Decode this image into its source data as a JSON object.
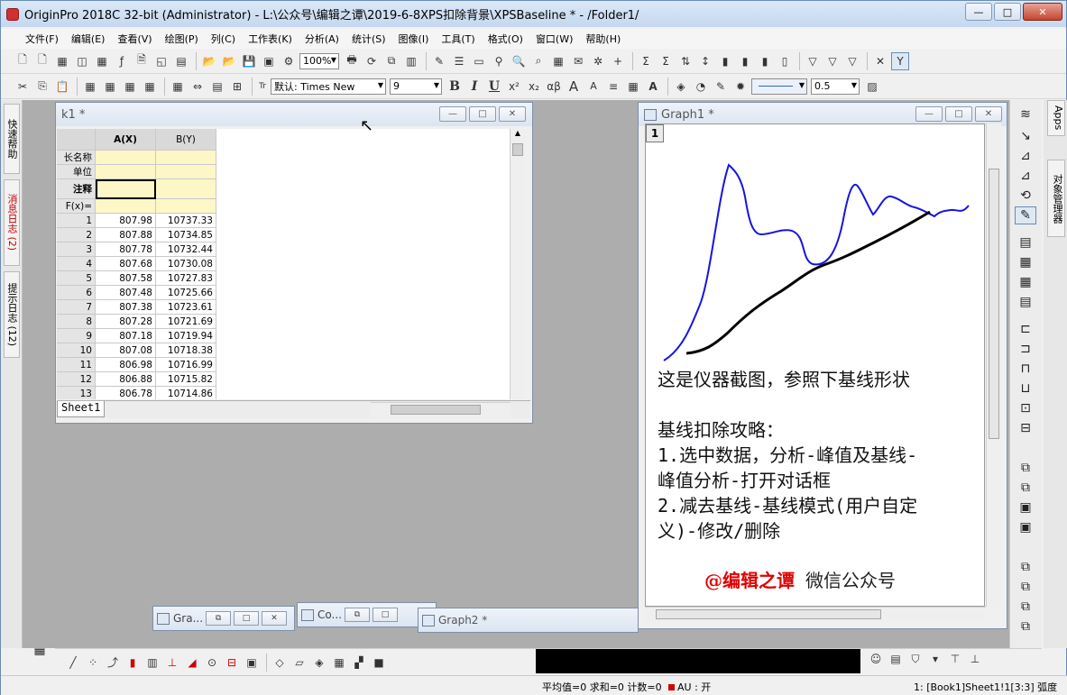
{
  "window": {
    "title": "OriginPro 2018C 32-bit (Administrator) - L:\\公众号\\编辑之谭\\2019-6-8XPS扣除背景\\XPSBaseline * - /Folder1/",
    "minimize": "—",
    "maximize": "□",
    "close": "✕"
  },
  "menu": [
    "文件(F)",
    "编辑(E)",
    "查看(V)",
    "绘图(P)",
    "列(C)",
    "工作表(K)",
    "分析(A)",
    "统计(S)",
    "图像(I)",
    "工具(T)",
    "格式(O)",
    "窗口(W)",
    "帮助(H)"
  ],
  "toolbar": {
    "zoom": "100%",
    "font_name": "默认: Times New",
    "font_size": "9",
    "line_width": "0.5",
    "bold": "B",
    "italic": "I",
    "underline": "U",
    "sup": "x²",
    "sub": "x₂",
    "greek": "αβ",
    "font_up": "A",
    "font_down": "A"
  },
  "left_dock": {
    "tab1": "快速帮助",
    "tab2": "消息日志 (2)",
    "tab3": "提示日志 (12)"
  },
  "right_dock": {
    "tab1": "Apps",
    "tab2": "对象管理器"
  },
  "workbook": {
    "title": "k1 *",
    "columns": [
      "A(X)",
      "B(Y)"
    ],
    "meta_rows": [
      "长名称",
      "单位",
      "注释",
      "F(x)="
    ],
    "rows": [
      [
        "1",
        "807.98",
        "10737.33"
      ],
      [
        "2",
        "807.88",
        "10734.85"
      ],
      [
        "3",
        "807.78",
        "10732.44"
      ],
      [
        "4",
        "807.68",
        "10730.08"
      ],
      [
        "5",
        "807.58",
        "10727.83"
      ],
      [
        "6",
        "807.48",
        "10725.66"
      ],
      [
        "7",
        "807.38",
        "10723.61"
      ],
      [
        "8",
        "807.28",
        "10721.69"
      ],
      [
        "9",
        "807.18",
        "10719.94"
      ],
      [
        "10",
        "807.08",
        "10718.38"
      ],
      [
        "11",
        "806.98",
        "10716.99"
      ],
      [
        "12",
        "806.88",
        "10715.82"
      ],
      [
        "13",
        "806.78",
        "10714.86"
      ]
    ],
    "sheet_tab": "Sheet1"
  },
  "graph": {
    "title": "Graph1 *",
    "layer": "1",
    "text_line1": "这是仪器截图，参照下基线形状",
    "text_line2": "基线扣除攻略：",
    "text_line3": "1.选中数据，分析-峰值及基线-",
    "text_line4": "峰值分析-打开对话框",
    "text_line5": "2.减去基线-基线模式(用户自定",
    "text_line6": "义)-修改/删除",
    "footer_red": "@编辑之谭",
    "footer_plain": " 微信公众号",
    "colors": {
      "signal": "#1515e0",
      "baseline": "#000000"
    }
  },
  "minimized": [
    {
      "label": "Gra..."
    },
    {
      "label": "Co..."
    },
    {
      "label": "Graph2 *"
    }
  ],
  "status": {
    "stats": "平均值=0 求和=0 计数=0",
    "au": "AU : 开",
    "right": "1: [Book1]Sheet1!1[3:3]  弧度"
  }
}
